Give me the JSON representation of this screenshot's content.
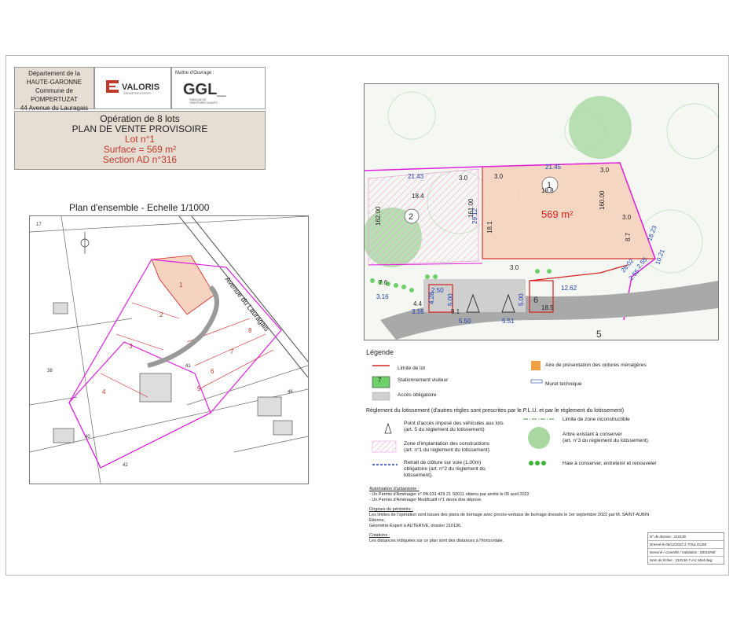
{
  "header": {
    "dept": [
      "Département de la",
      "HAUTE-GARONNE"
    ],
    "commune": "Commune de POMPERTUZAT",
    "address": "44 Avenue du Lauragais",
    "logo_text": "VALORIS",
    "logo_sub": "GÉOMÈTRE-EXPERT",
    "mo_label": "Maître d'Ouvrage :",
    "mo_logo": "GGL_",
    "mo_sub": [
      "FABRIQUE DE",
      "TERRITOIRES VIVANTS"
    ]
  },
  "operation": {
    "line1": "Opération de 8 lots",
    "line2": "PLAN DE VENTE PROVISOIRE",
    "lot": "Lot n°1",
    "surface": "Surface = 569 m²",
    "section": "Section AD n°316"
  },
  "ensemble": {
    "title": "Plan d'ensemble - Echelle 1/1000",
    "street": "Avenue du Lauragais",
    "lots": [
      "1",
      "2",
      "3",
      "4",
      "5",
      "6",
      "7",
      "8"
    ],
    "parcels": [
      "17",
      "38",
      "40",
      "41",
      "42",
      "46"
    ]
  },
  "plan": {
    "area": "569 m²",
    "lot_numbers": [
      "1",
      "2",
      "5",
      "6"
    ],
    "dims": {
      "d2143": "21.43",
      "d2145": "21.45",
      "d30a": "3.0",
      "d30b": "3.0",
      "d30c": "3.0",
      "d30d": "3.0",
      "d30e": "3.0",
      "d184": "18.4",
      "d188": "18.8",
      "d16200": "162.00",
      "d16100": "161.00",
      "d16000": "160.00",
      "d1823": "18.23",
      "d2912": "29.12",
      "d181": "18.1",
      "d87": "8.7",
      "d76": "7.6",
      "d44": "4.4",
      "d91": "9.1",
      "d185": "18.5",
      "d255a": "2.55",
      "d255b": "2.55",
      "d2602": "26.02",
      "d1021": "10.21",
      "d1262": "12.62",
      "d250": "2.50",
      "d500a": "5.00",
      "d500b": "5.00",
      "d316a": "3.16",
      "d316b": "3.16",
      "d550": "5.50",
      "d551": "5.51",
      "d428": "4.28"
    }
  },
  "legend": {
    "title": "Légende",
    "items": {
      "limite": "Limite de lot",
      "stationnement": "Stationnement visiteur",
      "stationnement_num": "7",
      "acces": "Accès obligatoire",
      "ordures": "Aire de présentation des ordures ménagères",
      "muret": "Muret technique"
    },
    "reglement_title": "Règlement du lotissement (d'autres règles sont prescrites par le P.L.U. et par le règlement du lotissement)",
    "reglement": {
      "point_acces": [
        "Point d'accès imposé des véhicules aux lots",
        "(art. 5 du règlement du lotissement)"
      ],
      "zone_impl": [
        "Zone d'implantation des constructions",
        "(art. n°1 du règlement du lotissement)."
      ],
      "retrait": [
        "Retrait de clôture sur voie (1.00m)",
        "obligatoire (art. n°2 du règlement du",
        "lotissement)."
      ],
      "limite_zone": "Limite de zone inconstructible",
      "arbre": [
        "Arbre existant à conserver",
        "(art. n°3 du règlement du lotissement)."
      ],
      "haie": "Haie à conserver, entretenir et renouveler"
    }
  },
  "notes": {
    "urb_title": "Autorisation d'urbanisme :",
    "urb1": "- Un Permis d'Aménager n° PA 031 429 21 S0011 obtenu par arrêté le 05 avril 2022",
    "urb2": "- Un Permis d'Aménager Modificatif n°1 devra être déposé.",
    "orig_title": "Origines du périmètre :",
    "orig1": "Les limites de l'opération sont issues des plans de bornage avec procès-verbaux de bornage dressés le 1er septembre 2022 par M. SAINT-AUBIN Etienne,",
    "orig2": "Géomètre-Expert à AUTERIVE, dossier 210136.",
    "cot_title": "Cotations :",
    "cot1": "Les distances indiquées sur ce plan sont des distances à l'horizontale."
  },
  "cartouche": [
    "N° de dossier : 210136",
    "Dressé le 06/12/2022 à TOULOUSE",
    "Dessiné / Contrôlé / Validation : DESSINÉ",
    "Nom du fichier : 210136-7-IA1 Mod.dwg"
  ],
  "colors": {
    "magenta": "#e020e0",
    "red": "#d62020",
    "lot1_fill": "#f6d3bf",
    "hatch": "#e8a0d8",
    "green": "#6fcf6a",
    "tan": "#e6ddd3"
  }
}
